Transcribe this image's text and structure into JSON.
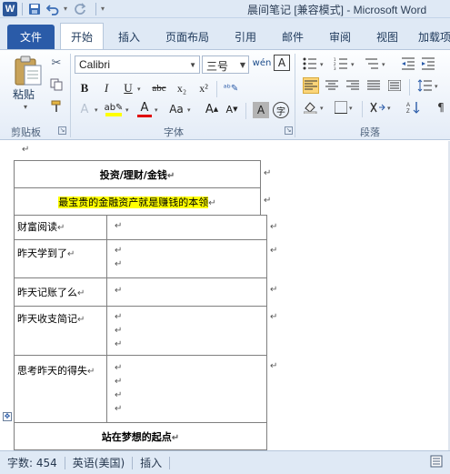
{
  "window": {
    "title": "晨间笔记 [兼容模式] - Microsoft Word",
    "app_logo": "W"
  },
  "quick_access": {
    "icons": [
      "save-icon",
      "undo-icon",
      "redo-icon",
      "customize-icon"
    ]
  },
  "tabs": [
    {
      "label": "文件"
    },
    {
      "label": "开始"
    },
    {
      "label": "插入"
    },
    {
      "label": "页面布局"
    },
    {
      "label": "引用"
    },
    {
      "label": "邮件"
    },
    {
      "label": "审阅"
    },
    {
      "label": "视图"
    },
    {
      "label": "加载项"
    }
  ],
  "ribbon": {
    "clipboard": {
      "paste_label": "粘贴",
      "group_label": "剪贴板"
    },
    "font": {
      "font_name": "Calibri",
      "font_size": "三号",
      "group_label": "字体",
      "bold": "B",
      "italic": "I",
      "underline": "U",
      "strike": "abc",
      "subscript": "x₂",
      "superscript": "x²",
      "highlight_color": "#ffff00",
      "font_color": "#e00000",
      "grow": "A",
      "shrink": "A",
      "change_case": "Aa",
      "char_shading": "A",
      "wen": "wén",
      "enclose": "字"
    },
    "paragraph": {
      "group_label": "段落"
    }
  },
  "document": {
    "header_rows": [
      {
        "text": "投资/理财/金钱"
      },
      {
        "text": "最宝贵的金融资产就是赚钱的本领",
        "highlight": "#ffff00"
      }
    ],
    "rows": [
      {
        "label": "财富阅读",
        "marks": 1
      },
      {
        "label": "昨天学到了",
        "marks": 2
      },
      {
        "label": "昨天记账了么",
        "marks": 1
      },
      {
        "label": "昨天收支简记",
        "marks": 3
      },
      {
        "label": "思考昨天的得失",
        "marks": 4
      }
    ],
    "footer_row": {
      "text": "站在梦想的起点"
    },
    "para_mark": "↵"
  },
  "statusbar": {
    "word_count": "字数: 454",
    "language": "英语(美国)",
    "mode": "插入"
  }
}
